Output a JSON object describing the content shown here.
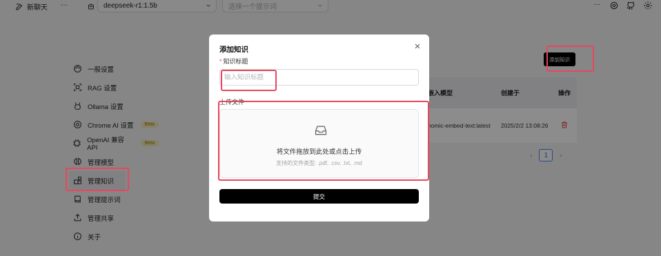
{
  "topbar": {
    "new_chat_label": "新聊天",
    "more_label": "···",
    "model_value": "deepseek-r1:1.5b",
    "prompt_placeholder": "选择一个提示词"
  },
  "sidebar": {
    "items": [
      {
        "label": "一般设置",
        "icon": "palette-icon"
      },
      {
        "label": "RAG 设置",
        "icon": "rag-icon"
      },
      {
        "label": "Ollama 设置",
        "icon": "ollama-icon"
      },
      {
        "label": "Chrome AI 设置",
        "icon": "chrome-icon",
        "badge": "Beta"
      },
      {
        "label": "OpenAI 兼容 API",
        "icon": "chip-icon",
        "badge": "Beta"
      },
      {
        "label": "管理模型",
        "icon": "brain-icon"
      },
      {
        "label": "管理知识",
        "icon": "blocks-icon",
        "active": true
      },
      {
        "label": "管理提示词",
        "icon": "book-icon"
      },
      {
        "label": "管理共享",
        "icon": "share-icon"
      },
      {
        "label": "关于",
        "icon": "info-icon"
      }
    ]
  },
  "knowledge": {
    "add_button": "添加知识",
    "columns": [
      "嵌入模型",
      "创建于",
      "操作"
    ],
    "rows": [
      {
        "model": "nomic-embed-text:latest",
        "created": "2025/2/2 13:08:26"
      }
    ],
    "page": "1",
    "prev": "‹",
    "next": "›"
  },
  "modal": {
    "title": "添加知识",
    "title_field_label": "知识标题",
    "title_placeholder": "输入知识标题",
    "upload_label": "上传文件",
    "drop_main": "将文件拖放到此处或点击上传",
    "drop_sub": "支持的文件类型: .pdf, .csv, .txt, .md",
    "submit": "提交"
  },
  "colors": {
    "highlight": "#e8455e",
    "primary": "#000000",
    "delete": "#e5484d",
    "beta_badge": "#f6e9b5"
  }
}
